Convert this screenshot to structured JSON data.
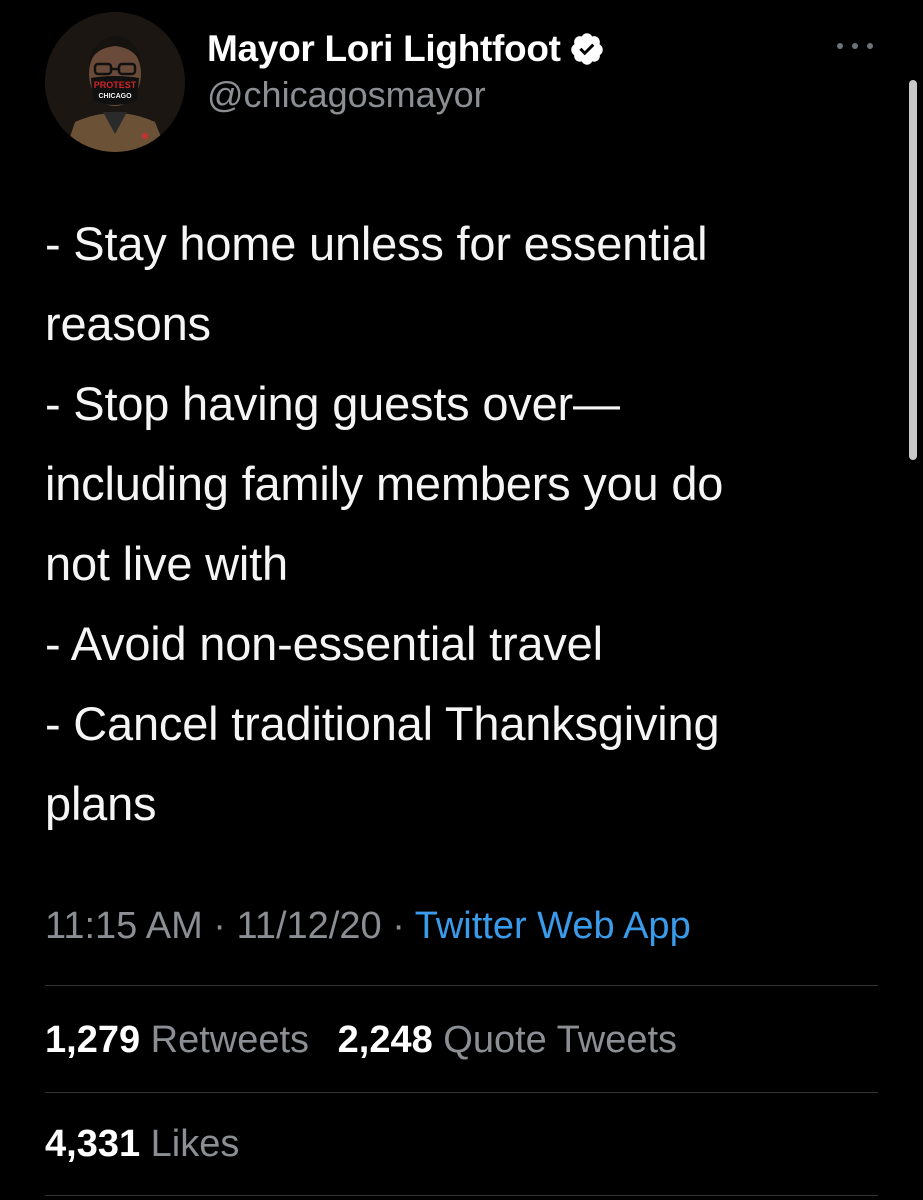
{
  "author": {
    "display_name": "Mayor Lori Lightfoot",
    "handle": "@chicagosmayor",
    "verified": true,
    "avatar_mask_text_top": "PROTEST",
    "avatar_mask_text_bottom": "CHICAGO"
  },
  "tweet": {
    "lines": [
      "- Stay home unless for essential",
      "reasons",
      "- Stop having guests over—",
      "including family members you do",
      "not live with",
      "- Avoid non-essential travel",
      "- Cancel traditional Thanksgiving",
      "plans"
    ]
  },
  "meta": {
    "time": "11:15 AM",
    "separator": "·",
    "date": "11/12/20",
    "source": "Twitter Web App"
  },
  "stats": {
    "retweets_count": "1,279",
    "retweets_label": "Retweets",
    "quote_tweets_count": "2,248",
    "quote_tweets_label": "Quote Tweets",
    "likes_count": "4,331",
    "likes_label": "Likes"
  },
  "colors": {
    "background": "#000000",
    "link": "#3a9bea",
    "secondary_text": "#8b8f94",
    "divider": "#2f3336"
  },
  "icons": {
    "verified": "verified-badge-icon",
    "more": "more-horizontal-icon"
  }
}
